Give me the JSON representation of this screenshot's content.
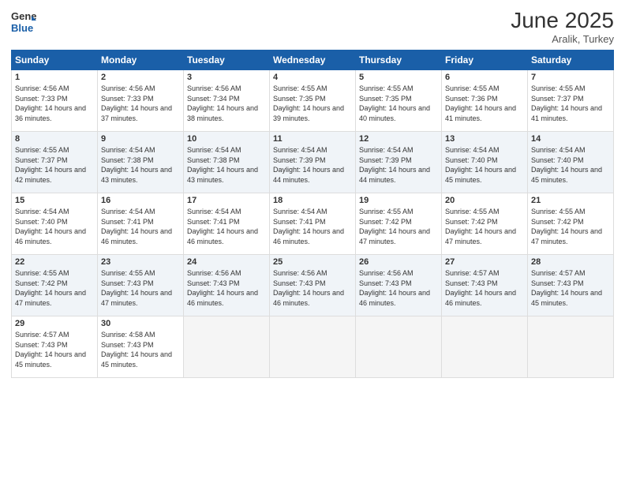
{
  "header": {
    "logo_line1": "General",
    "logo_line2": "Blue",
    "month_year": "June 2025",
    "location": "Aralik, Turkey"
  },
  "days_of_week": [
    "Sunday",
    "Monday",
    "Tuesday",
    "Wednesday",
    "Thursday",
    "Friday",
    "Saturday"
  ],
  "weeks": [
    [
      {
        "day": "1",
        "sunrise": "4:56 AM",
        "sunset": "7:33 PM",
        "daylight": "14 hours and 36 minutes."
      },
      {
        "day": "2",
        "sunrise": "4:56 AM",
        "sunset": "7:33 PM",
        "daylight": "14 hours and 37 minutes."
      },
      {
        "day": "3",
        "sunrise": "4:56 AM",
        "sunset": "7:34 PM",
        "daylight": "14 hours and 38 minutes."
      },
      {
        "day": "4",
        "sunrise": "4:55 AM",
        "sunset": "7:35 PM",
        "daylight": "14 hours and 39 minutes."
      },
      {
        "day": "5",
        "sunrise": "4:55 AM",
        "sunset": "7:35 PM",
        "daylight": "14 hours and 40 minutes."
      },
      {
        "day": "6",
        "sunrise": "4:55 AM",
        "sunset": "7:36 PM",
        "daylight": "14 hours and 41 minutes."
      },
      {
        "day": "7",
        "sunrise": "4:55 AM",
        "sunset": "7:37 PM",
        "daylight": "14 hours and 41 minutes."
      }
    ],
    [
      {
        "day": "8",
        "sunrise": "4:55 AM",
        "sunset": "7:37 PM",
        "daylight": "14 hours and 42 minutes."
      },
      {
        "day": "9",
        "sunrise": "4:54 AM",
        "sunset": "7:38 PM",
        "daylight": "14 hours and 43 minutes."
      },
      {
        "day": "10",
        "sunrise": "4:54 AM",
        "sunset": "7:38 PM",
        "daylight": "14 hours and 43 minutes."
      },
      {
        "day": "11",
        "sunrise": "4:54 AM",
        "sunset": "7:39 PM",
        "daylight": "14 hours and 44 minutes."
      },
      {
        "day": "12",
        "sunrise": "4:54 AM",
        "sunset": "7:39 PM",
        "daylight": "14 hours and 44 minutes."
      },
      {
        "day": "13",
        "sunrise": "4:54 AM",
        "sunset": "7:40 PM",
        "daylight": "14 hours and 45 minutes."
      },
      {
        "day": "14",
        "sunrise": "4:54 AM",
        "sunset": "7:40 PM",
        "daylight": "14 hours and 45 minutes."
      }
    ],
    [
      {
        "day": "15",
        "sunrise": "4:54 AM",
        "sunset": "7:40 PM",
        "daylight": "14 hours and 46 minutes."
      },
      {
        "day": "16",
        "sunrise": "4:54 AM",
        "sunset": "7:41 PM",
        "daylight": "14 hours and 46 minutes."
      },
      {
        "day": "17",
        "sunrise": "4:54 AM",
        "sunset": "7:41 PM",
        "daylight": "14 hours and 46 minutes."
      },
      {
        "day": "18",
        "sunrise": "4:54 AM",
        "sunset": "7:41 PM",
        "daylight": "14 hours and 46 minutes."
      },
      {
        "day": "19",
        "sunrise": "4:55 AM",
        "sunset": "7:42 PM",
        "daylight": "14 hours and 47 minutes."
      },
      {
        "day": "20",
        "sunrise": "4:55 AM",
        "sunset": "7:42 PM",
        "daylight": "14 hours and 47 minutes."
      },
      {
        "day": "21",
        "sunrise": "4:55 AM",
        "sunset": "7:42 PM",
        "daylight": "14 hours and 47 minutes."
      }
    ],
    [
      {
        "day": "22",
        "sunrise": "4:55 AM",
        "sunset": "7:42 PM",
        "daylight": "14 hours and 47 minutes."
      },
      {
        "day": "23",
        "sunrise": "4:55 AM",
        "sunset": "7:43 PM",
        "daylight": "14 hours and 47 minutes."
      },
      {
        "day": "24",
        "sunrise": "4:56 AM",
        "sunset": "7:43 PM",
        "daylight": "14 hours and 46 minutes."
      },
      {
        "day": "25",
        "sunrise": "4:56 AM",
        "sunset": "7:43 PM",
        "daylight": "14 hours and 46 minutes."
      },
      {
        "day": "26",
        "sunrise": "4:56 AM",
        "sunset": "7:43 PM",
        "daylight": "14 hours and 46 minutes."
      },
      {
        "day": "27",
        "sunrise": "4:57 AM",
        "sunset": "7:43 PM",
        "daylight": "14 hours and 46 minutes."
      },
      {
        "day": "28",
        "sunrise": "4:57 AM",
        "sunset": "7:43 PM",
        "daylight": "14 hours and 45 minutes."
      }
    ],
    [
      {
        "day": "29",
        "sunrise": "4:57 AM",
        "sunset": "7:43 PM",
        "daylight": "14 hours and 45 minutes."
      },
      {
        "day": "30",
        "sunrise": "4:58 AM",
        "sunset": "7:43 PM",
        "daylight": "14 hours and 45 minutes."
      },
      null,
      null,
      null,
      null,
      null
    ]
  ]
}
